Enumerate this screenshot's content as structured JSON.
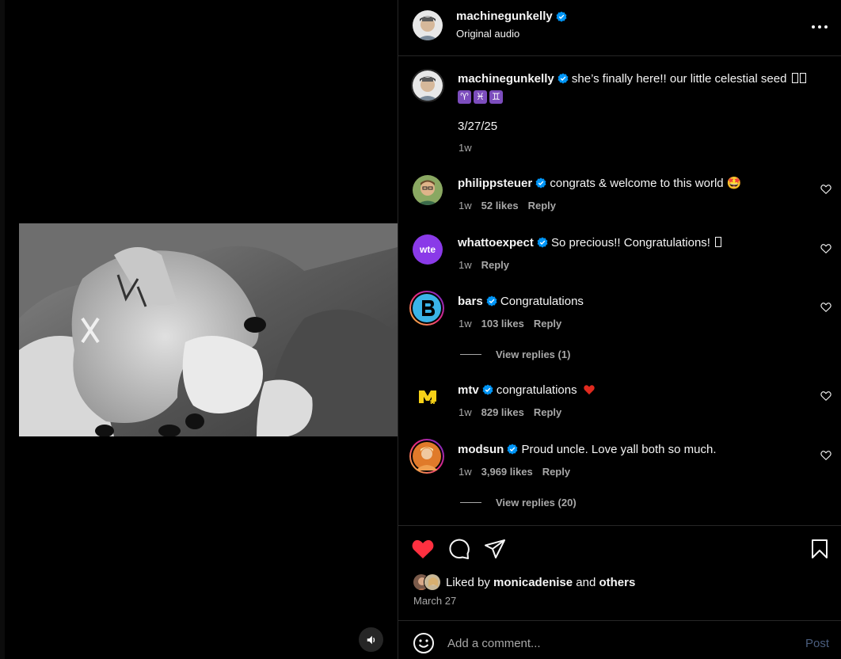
{
  "post": {
    "username": "machinegunkelly",
    "audio": "Original audio",
    "caption": "she’s finally here!! our little celestial seed",
    "caption_zodiac": [
      "♈",
      "♓",
      "♊"
    ],
    "caption_date": "3/27/25",
    "caption_age": "1w"
  },
  "comments": [
    {
      "username": "philippsteuer",
      "text": "congrats & welcome to this world 🤩",
      "age": "1w",
      "likes": "52 likes",
      "reply": "Reply"
    },
    {
      "username": "whattoexpect",
      "text": "So precious!! Congratulations!",
      "age": "1w",
      "reply": "Reply",
      "avatar_text": "wte"
    },
    {
      "username": "bars",
      "text": "Congratulations",
      "age": "1w",
      "likes": "103 likes",
      "reply": "Reply",
      "view_replies": "View replies (1)"
    },
    {
      "username": "mtv",
      "text": "congratulations",
      "age": "1w",
      "likes": "829 likes",
      "reply": "Reply"
    },
    {
      "username": "modsun",
      "text": "Proud uncle. Love yall both so much.",
      "age": "1w",
      "likes": "3,969 likes",
      "reply": "Reply",
      "view_replies": "View replies (20)"
    }
  ],
  "likes": {
    "prefix": "Liked by",
    "user": "monicadenise",
    "joiner": "and",
    "others": "others"
  },
  "post_date": "March 27",
  "comment_box": {
    "placeholder": "Add a comment...",
    "post_label": "Post"
  },
  "colors": {
    "like_red": "#ff3040",
    "verified_blue": "#0095f6",
    "muted_text": "#a8a8a8"
  },
  "icons": {
    "more": "more-options-icon",
    "like": "heart-filled-icon",
    "comment": "comment-bubble-icon",
    "share": "paper-plane-icon",
    "save": "bookmark-icon",
    "mute": "speaker-icon",
    "emoji": "emoji-icon"
  }
}
